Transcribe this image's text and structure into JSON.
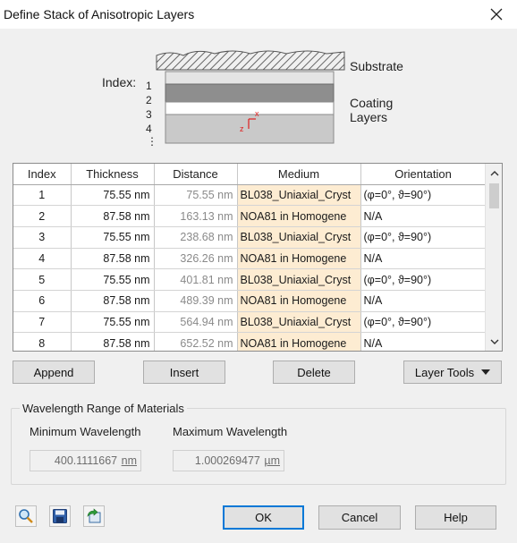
{
  "window": {
    "title": "Define Stack of Anisotropic Layers"
  },
  "diagram": {
    "index_label": "Index:",
    "index_numbers": [
      "1",
      "2",
      "3",
      "4",
      "⋮"
    ],
    "substrate_label": "Substrate",
    "coating_label_1": "Coating",
    "coating_label_2": "Layers",
    "axis_z": "z",
    "axis_x": "x"
  },
  "table": {
    "columns": [
      "Index",
      "Thickness",
      "Distance",
      "Medium",
      "Orientation"
    ],
    "rows": [
      {
        "index": "1",
        "thickness": "75.55 nm",
        "distance": "75.55 nm",
        "medium": "BL038_Uniaxial_Cryst",
        "orientation": "(φ=0°, ϑ=90°)"
      },
      {
        "index": "2",
        "thickness": "87.58 nm",
        "distance": "163.13 nm",
        "medium": "NOA81 in Homogene",
        "orientation": "N/A"
      },
      {
        "index": "3",
        "thickness": "75.55 nm",
        "distance": "238.68 nm",
        "medium": "BL038_Uniaxial_Cryst",
        "orientation": "(φ=0°, ϑ=90°)"
      },
      {
        "index": "4",
        "thickness": "87.58 nm",
        "distance": "326.26 nm",
        "medium": "NOA81 in Homogene",
        "orientation": "N/A"
      },
      {
        "index": "5",
        "thickness": "75.55 nm",
        "distance": "401.81 nm",
        "medium": "BL038_Uniaxial_Cryst",
        "orientation": "(φ=0°, ϑ=90°)"
      },
      {
        "index": "6",
        "thickness": "87.58 nm",
        "distance": "489.39 nm",
        "medium": "NOA81 in Homogene",
        "orientation": "N/A"
      },
      {
        "index": "7",
        "thickness": "75.55 nm",
        "distance": "564.94 nm",
        "medium": "BL038_Uniaxial_Cryst",
        "orientation": "(φ=0°, ϑ=90°)"
      },
      {
        "index": "8",
        "thickness": "87.58 nm",
        "distance": "652.52 nm",
        "medium": "NOA81 in Homogene",
        "orientation": "N/A"
      }
    ]
  },
  "buttons": {
    "append": "Append",
    "insert": "Insert",
    "delete": "Delete",
    "layer_tools": "Layer Tools",
    "ok": "OK",
    "cancel": "Cancel",
    "help": "Help"
  },
  "wavelength": {
    "group_title": "Wavelength Range of Materials",
    "min_label": "Minimum Wavelength",
    "max_label": "Maximum Wavelength",
    "min_value": "400.1111667",
    "min_unit": "nm",
    "max_value": "1.000269477",
    "max_unit": "µm"
  },
  "colors": {
    "medium_cell_bg": "#fdecd2",
    "ok_border": "#0078d7",
    "axis_red": "#e02020"
  },
  "icons": [
    "search-icon",
    "save-icon",
    "export-icon"
  ]
}
